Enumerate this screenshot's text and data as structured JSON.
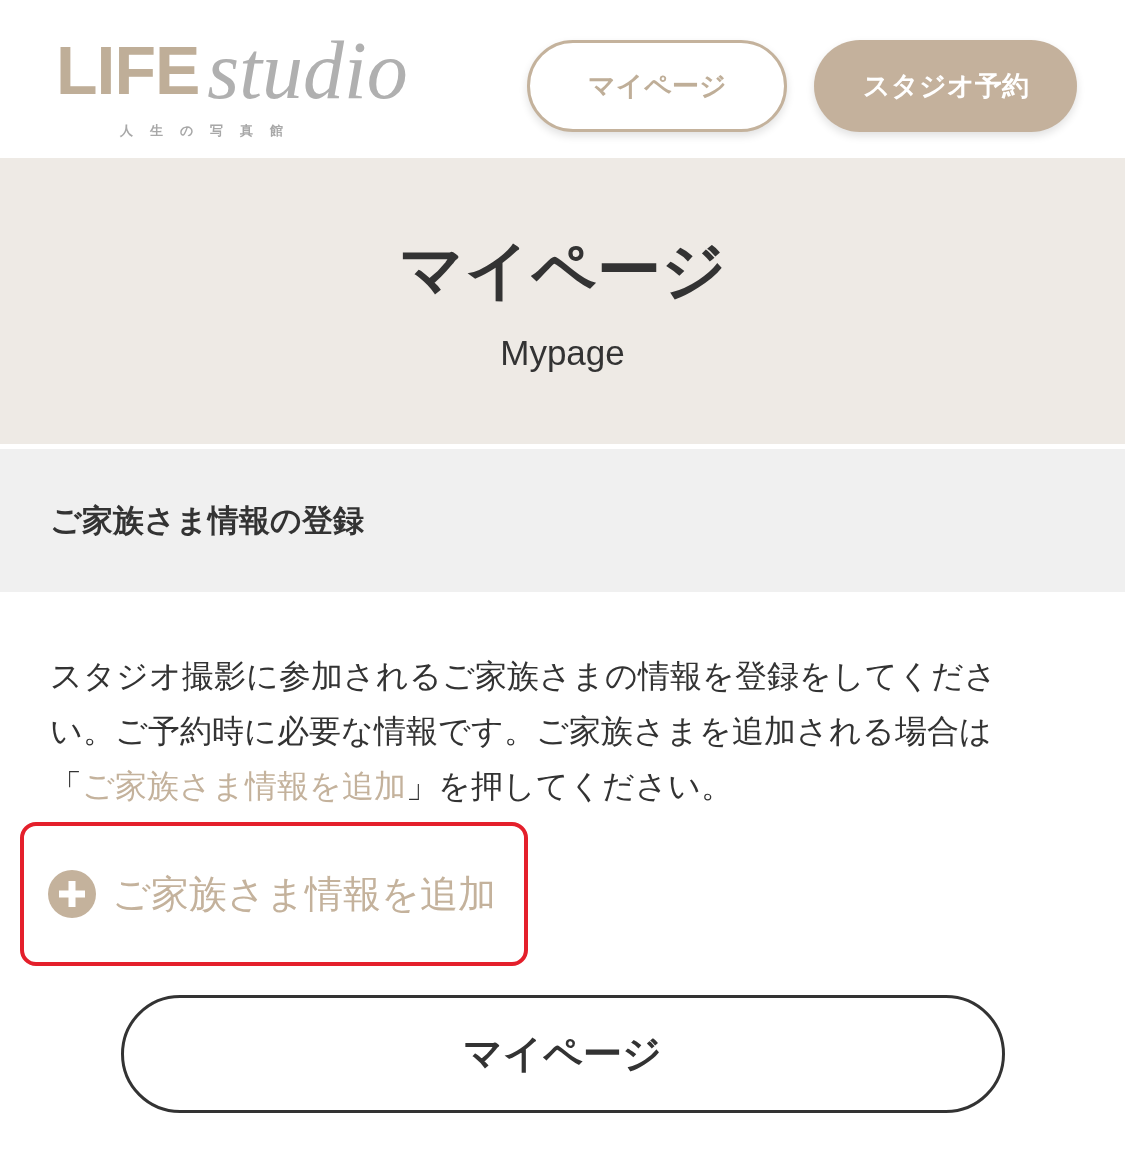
{
  "header": {
    "logo": {
      "wordmark": "LIFE",
      "script": "studio",
      "tagline": "人生の写真館"
    },
    "nav_buttons": [
      {
        "label": "マイページ",
        "kind": "outline"
      },
      {
        "label": "スタジオ予約",
        "kind": "filled"
      }
    ]
  },
  "banner": {
    "title": "マイページ",
    "subtitle": "Mypage"
  },
  "section": {
    "heading": "ご家族さま情報の登録",
    "intro": {
      "before": "スタジオ撮影に参加されるご家族さまの情報を登録をしてください。ご予約時に必要な情報です。ご家族さまを追加される場合は「",
      "link": "ご家族さま情報を追加",
      "after": "」を押してください。"
    }
  },
  "add_link": {
    "label": "ご家族さま情報を追加",
    "highlighted": true
  },
  "bottom_button": {
    "label": "マイページ"
  }
}
